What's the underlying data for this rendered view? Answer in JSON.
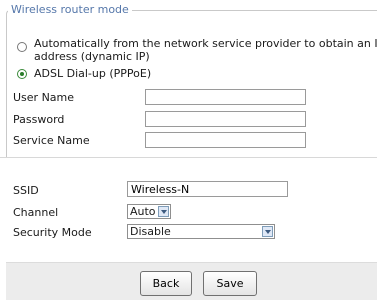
{
  "section": {
    "legend": "Wireless router mode",
    "radio_dynamic_line1": "Automatically from the network service provider to obtain an IP",
    "radio_dynamic_line2": "address (dynamic IP)",
    "radio_pppoe": "ADSL Dial-up (PPPoE)",
    "selected_mode": "ADSL Dial-up (PPPoE)"
  },
  "pppoe": {
    "user_name_label": "User Name",
    "user_name_value": "",
    "password_label": "Password",
    "password_value": "",
    "service_name_label": "Service Name",
    "service_name_value": ""
  },
  "wireless": {
    "ssid_label": "SSID",
    "ssid_value": "Wireless-N",
    "channel_label": "Channel",
    "channel_value": "Auto",
    "security_label": "Security Mode",
    "security_value": "Disable"
  },
  "buttons": {
    "back": "Back",
    "save": "Save"
  },
  "colors": {
    "legend": "#5577aa",
    "footer_bg": "#ececec",
    "radio_selected": "#2a7d2a"
  }
}
